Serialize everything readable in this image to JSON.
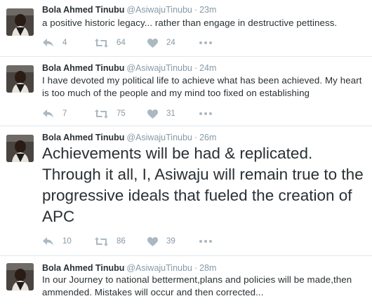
{
  "tweets": [
    {
      "name": "Bola Ahmed Tinubu",
      "handle": "@AsiwajuTinubu",
      "time": "23m",
      "text": "a positive historic legacy... rather than engage in destructive pettiness.",
      "replies": "4",
      "retweets": "64",
      "likes": "24",
      "large": false
    },
    {
      "name": "Bola Ahmed Tinubu",
      "handle": "@AsiwajuTinubu",
      "time": "24m",
      "text": "I have devoted my political life to achieve what has been achieved. My heart is too much of the people and my mind too fixed on establishing",
      "replies": "7",
      "retweets": "75",
      "likes": "31",
      "large": false
    },
    {
      "name": "Bola Ahmed Tinubu",
      "handle": "@AsiwajuTinubu",
      "time": "26m",
      "text": "Achievements will be had & replicated. Through it all, I, Asiwaju will remain true to the progressive ideals that fueled the creation of APC",
      "replies": "10",
      "retweets": "86",
      "likes": "39",
      "large": true
    },
    {
      "name": "Bola Ahmed Tinubu",
      "handle": "@AsiwajuTinubu",
      "time": "28m",
      "text": "In our Journey to national betterment,plans and policies will be made,then ammended. Mistakes will occur and then corrected...",
      "large": false
    }
  ],
  "separator": "·",
  "icons": {
    "reply": "reply-icon",
    "retweet": "retweet-icon",
    "like": "heart-icon",
    "more": "more-icon",
    "avatar": "profile-photo"
  },
  "colors": {
    "text": "#292f33",
    "meta": "#8899a6",
    "icon": "#aab8c2",
    "border": "#e1e8ed"
  }
}
